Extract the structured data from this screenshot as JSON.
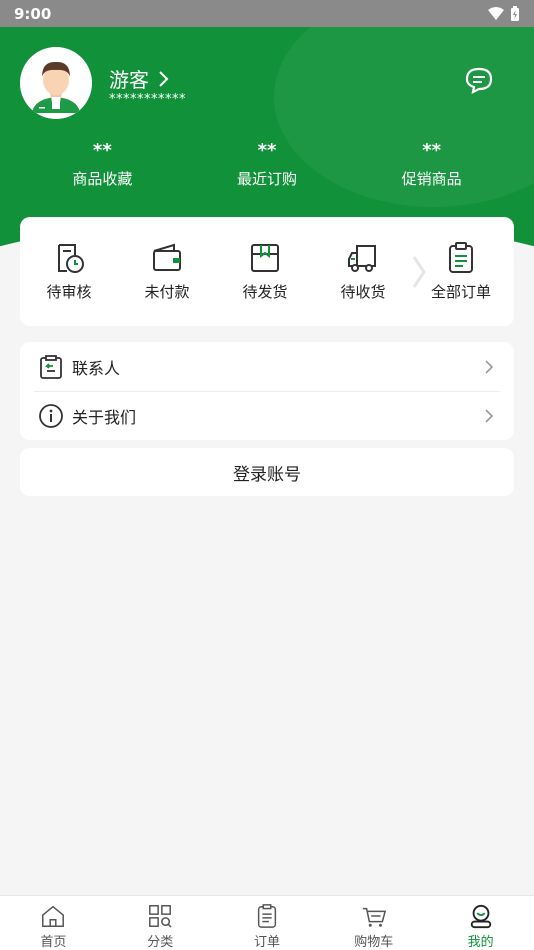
{
  "status_bar": {
    "time": "9:00"
  },
  "profile": {
    "name": "游客",
    "phone_masked": "***********"
  },
  "stats": [
    {
      "value": "**",
      "label": "商品收藏"
    },
    {
      "value": "**",
      "label": "最近订购"
    },
    {
      "value": "**",
      "label": "促销商品"
    }
  ],
  "orders": [
    {
      "label": "待审核",
      "icon": "pending-review-icon"
    },
    {
      "label": "未付款",
      "icon": "wallet-icon"
    },
    {
      "label": "待发货",
      "icon": "package-icon"
    },
    {
      "label": "待收货",
      "icon": "truck-icon"
    },
    {
      "label": "全部订单",
      "icon": "clipboard-list-icon"
    }
  ],
  "menu": [
    {
      "label": "联系人",
      "icon": "contact-clipboard-icon"
    },
    {
      "label": "关于我们",
      "icon": "info-icon"
    }
  ],
  "login_label": "登录账号",
  "tabs": [
    {
      "label": "首页",
      "icon": "home-icon"
    },
    {
      "label": "分类",
      "icon": "category-icon"
    },
    {
      "label": "订单",
      "icon": "order-icon"
    },
    {
      "label": "购物车",
      "icon": "cart-icon"
    },
    {
      "label": "我的",
      "icon": "profile-icon",
      "active": true
    }
  ],
  "colors": {
    "brand_green": "#11923a",
    "background": "#f5f5f5",
    "status_bar": "#8a8a8a"
  }
}
